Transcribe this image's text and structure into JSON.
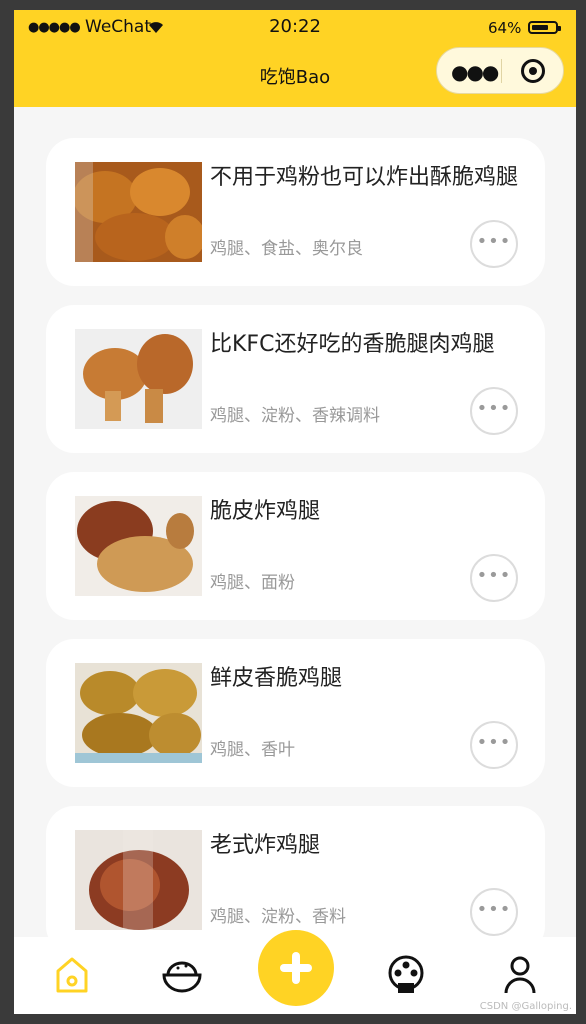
{
  "status_bar": {
    "signal": "●●●●●",
    "carrier": "WeChat",
    "time": "20:22",
    "battery": "64%"
  },
  "header": {
    "title": "吃饱Bao",
    "menu_icon": "more-dots-icon",
    "close_icon": "target-icon"
  },
  "recipes": [
    {
      "name": "不用于鸡粉也可以炸出酥脆鸡腿",
      "ingredients": "鸡腿、食盐、奥尔良"
    },
    {
      "name": "比KFC还好吃的香脆腿肉鸡腿",
      "ingredients": "鸡腿、淀粉、香辣调料"
    },
    {
      "name": "脆皮炸鸡腿",
      "ingredients": "鸡腿、面粉"
    },
    {
      "name": "鲜皮香脆鸡腿",
      "ingredients": "鸡腿、香叶"
    },
    {
      "name": "老式炸鸡腿",
      "ingredients": "鸡腿、淀粉、香料"
    }
  ],
  "more_button_label": "•••",
  "tabbar": {
    "items": [
      "home-icon",
      "rice-bowl-icon",
      "add-icon",
      "film-reel-icon",
      "user-icon"
    ],
    "active_color": "#ffd324"
  },
  "watermark": "CSDN @Galloping.",
  "colors": {
    "accent": "#ffd324",
    "background": "#f6f6f6"
  }
}
